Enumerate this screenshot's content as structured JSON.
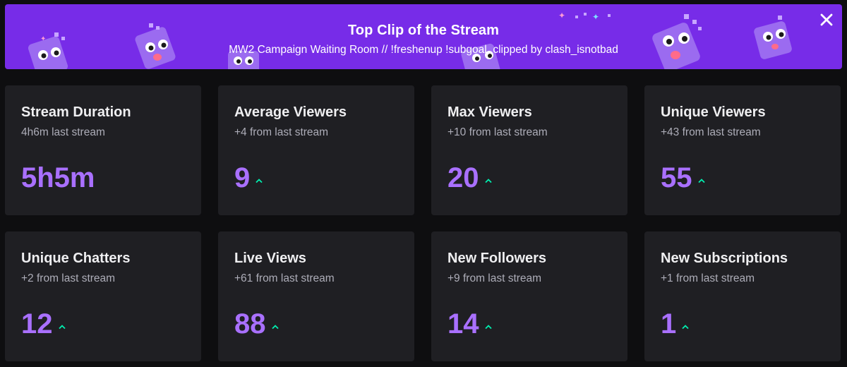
{
  "banner": {
    "title": "Top Clip of the Stream",
    "subtitle": "MW2 Campaign Waiting Room // !freshenup !subgoal, clipped by clash_isnotbad",
    "background_color": "#772ce8",
    "close_icon": "close-icon"
  },
  "colors": {
    "page_background": "#0e0e10",
    "card_background": "#1f1f23",
    "value_color": "#a970ff",
    "trend_up_color": "#00f0b0"
  },
  "stats": [
    {
      "title": "Stream Duration",
      "comparison": "4h6m last stream",
      "value": "5h5m",
      "trend": "none"
    },
    {
      "title": "Average Viewers",
      "comparison": "+4 from last stream",
      "value": "9",
      "trend": "up"
    },
    {
      "title": "Max Viewers",
      "comparison": "+10 from last stream",
      "value": "20",
      "trend": "up"
    },
    {
      "title": "Unique Viewers",
      "comparison": "+43 from last stream",
      "value": "55",
      "trend": "up"
    },
    {
      "title": "Unique Chatters",
      "comparison": "+2 from last stream",
      "value": "12",
      "trend": "up"
    },
    {
      "title": "Live Views",
      "comparison": "+61 from last stream",
      "value": "88",
      "trend": "up"
    },
    {
      "title": "New Followers",
      "comparison": "+9 from last stream",
      "value": "14",
      "trend": "up"
    },
    {
      "title": "New Subscriptions",
      "comparison": "+1 from last stream",
      "value": "1",
      "trend": "up"
    }
  ]
}
